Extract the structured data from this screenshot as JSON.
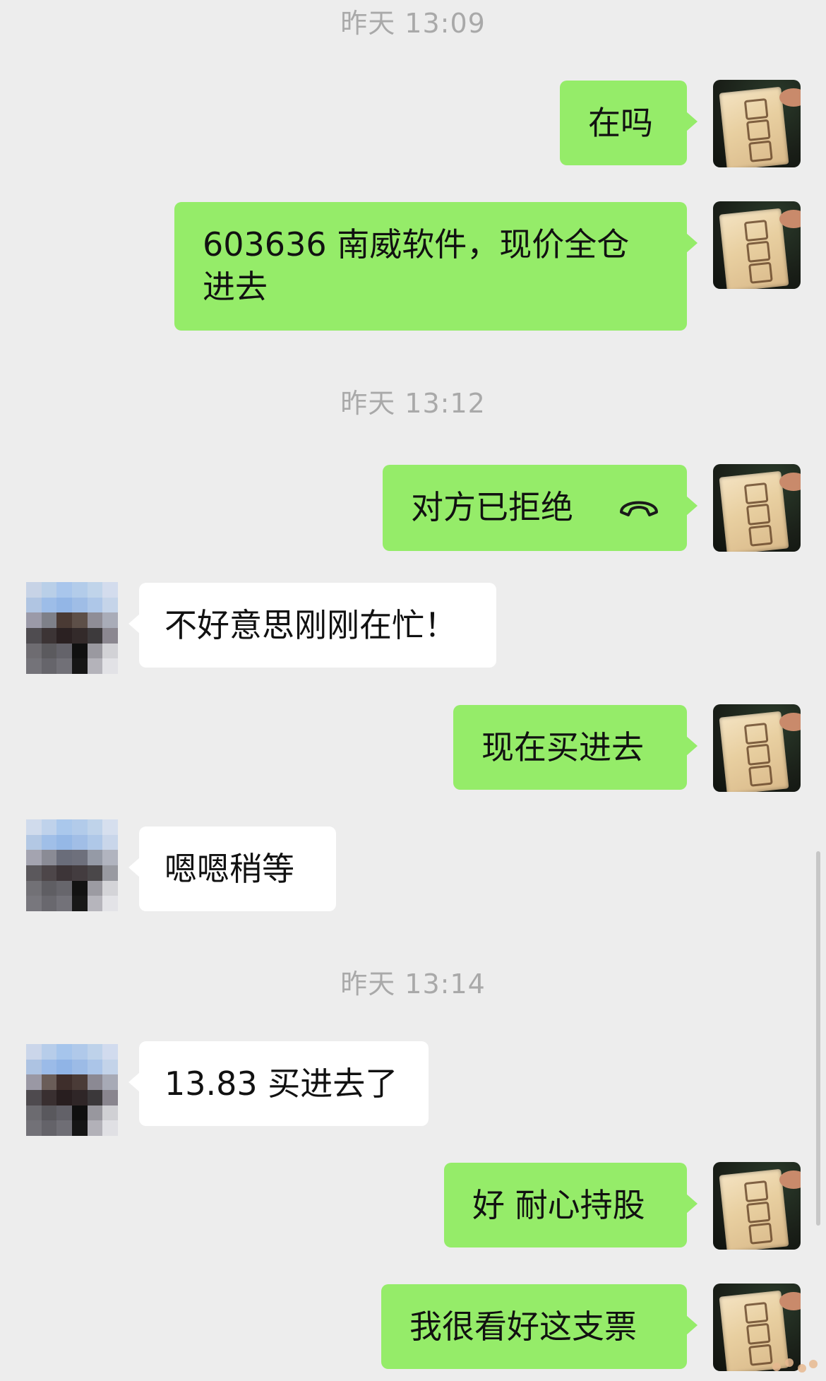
{
  "messages": [
    {
      "type": "time",
      "text": "昨天 13:09"
    },
    {
      "type": "outgoing",
      "text": "在吗"
    },
    {
      "type": "outgoing",
      "text": "603636 南威软件，现价全仓进去"
    },
    {
      "type": "time",
      "text": "昨天 13:12"
    },
    {
      "type": "outgoing_call",
      "text": "对方已拒绝",
      "icon": "phone-hangup-icon"
    },
    {
      "type": "incoming",
      "text": "不好意思刚刚在忙！"
    },
    {
      "type": "outgoing",
      "text": "现在买进去"
    },
    {
      "type": "incoming",
      "text": "嗯嗯稍等"
    },
    {
      "type": "time",
      "text": "昨天 13:14"
    },
    {
      "type": "incoming",
      "text": "13.83 买进去了"
    },
    {
      "type": "outgoing",
      "text": "好 耐心持股"
    },
    {
      "type": "outgoing",
      "text": "我很看好这支票"
    }
  ],
  "colors": {
    "background": "#ededed",
    "outgoing_bubble": "#95ec69",
    "incoming_bubble": "#ffffff",
    "timestamp": "#a9a9a9",
    "text": "#111111"
  }
}
